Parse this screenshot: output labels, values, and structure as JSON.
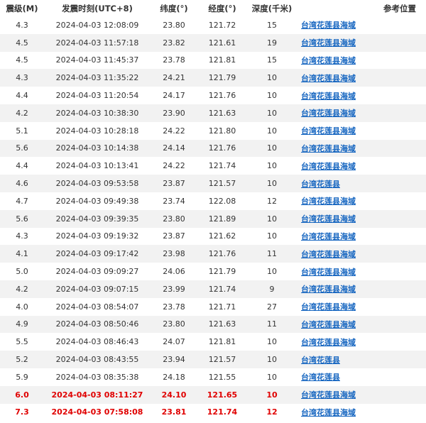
{
  "headers": {
    "magnitude": "震级(M)",
    "time": "发震时刻(UTC+8)",
    "lat": "纬度(°)",
    "lon": "经度(°)",
    "depth": "深度(千米)",
    "location": "参考位置"
  },
  "rows": [
    {
      "mag": "4.3",
      "time": "2024-04-03 12:08:09",
      "lat": "23.80",
      "lon": "121.72",
      "depth": "15",
      "loc": "台湾花莲县海域",
      "highlight": false
    },
    {
      "mag": "4.5",
      "time": "2024-04-03 11:57:18",
      "lat": "23.82",
      "lon": "121.61",
      "depth": "19",
      "loc": "台湾花莲县海域",
      "highlight": false
    },
    {
      "mag": "4.5",
      "time": "2024-04-03 11:45:37",
      "lat": "23.78",
      "lon": "121.81",
      "depth": "15",
      "loc": "台湾花莲县海域",
      "highlight": false
    },
    {
      "mag": "4.3",
      "time": "2024-04-03 11:35:22",
      "lat": "24.21",
      "lon": "121.79",
      "depth": "10",
      "loc": "台湾花莲县海域",
      "highlight": false
    },
    {
      "mag": "4.4",
      "time": "2024-04-03 11:20:54",
      "lat": "24.17",
      "lon": "121.76",
      "depth": "10",
      "loc": "台湾花莲县海域",
      "highlight": false
    },
    {
      "mag": "4.2",
      "time": "2024-04-03 10:38:30",
      "lat": "23.90",
      "lon": "121.63",
      "depth": "10",
      "loc": "台湾花莲县海域",
      "highlight": false
    },
    {
      "mag": "5.1",
      "time": "2024-04-03 10:28:18",
      "lat": "24.22",
      "lon": "121.80",
      "depth": "10",
      "loc": "台湾花莲县海域",
      "highlight": false
    },
    {
      "mag": "5.6",
      "time": "2024-04-03 10:14:38",
      "lat": "24.14",
      "lon": "121.76",
      "depth": "10",
      "loc": "台湾花莲县海域",
      "highlight": false
    },
    {
      "mag": "4.4",
      "time": "2024-04-03 10:13:41",
      "lat": "24.22",
      "lon": "121.74",
      "depth": "10",
      "loc": "台湾花莲县海域",
      "highlight": false
    },
    {
      "mag": "4.6",
      "time": "2024-04-03 09:53:58",
      "lat": "23.87",
      "lon": "121.57",
      "depth": "10",
      "loc": "台湾花莲县",
      "highlight": false
    },
    {
      "mag": "4.7",
      "time": "2024-04-03 09:49:38",
      "lat": "23.74",
      "lon": "122.08",
      "depth": "12",
      "loc": "台湾花莲县海域",
      "highlight": false
    },
    {
      "mag": "5.6",
      "time": "2024-04-03 09:39:35",
      "lat": "23.80",
      "lon": "121.89",
      "depth": "10",
      "loc": "台湾花莲县海域",
      "highlight": false
    },
    {
      "mag": "4.3",
      "time": "2024-04-03 09:19:32",
      "lat": "23.87",
      "lon": "121.62",
      "depth": "10",
      "loc": "台湾花莲县海域",
      "highlight": false
    },
    {
      "mag": "4.1",
      "time": "2024-04-03 09:17:42",
      "lat": "23.98",
      "lon": "121.76",
      "depth": "11",
      "loc": "台湾花莲县海域",
      "highlight": false
    },
    {
      "mag": "5.0",
      "time": "2024-04-03 09:09:27",
      "lat": "24.06",
      "lon": "121.79",
      "depth": "10",
      "loc": "台湾花莲县海域",
      "highlight": false
    },
    {
      "mag": "4.2",
      "time": "2024-04-03 09:07:15",
      "lat": "23.99",
      "lon": "121.74",
      "depth": "9",
      "loc": "台湾花莲县海域",
      "highlight": false
    },
    {
      "mag": "4.0",
      "time": "2024-04-03 08:54:07",
      "lat": "23.78",
      "lon": "121.71",
      "depth": "27",
      "loc": "台湾花莲县海域",
      "highlight": false
    },
    {
      "mag": "4.9",
      "time": "2024-04-03 08:50:46",
      "lat": "23.80",
      "lon": "121.63",
      "depth": "11",
      "loc": "台湾花莲县海域",
      "highlight": false
    },
    {
      "mag": "5.5",
      "time": "2024-04-03 08:46:43",
      "lat": "24.07",
      "lon": "121.81",
      "depth": "10",
      "loc": "台湾花莲县海域",
      "highlight": false
    },
    {
      "mag": "5.2",
      "time": "2024-04-03 08:43:55",
      "lat": "23.94",
      "lon": "121.57",
      "depth": "10",
      "loc": "台湾花莲县",
      "highlight": false
    },
    {
      "mag": "5.9",
      "time": "2024-04-03 08:35:38",
      "lat": "24.18",
      "lon": "121.55",
      "depth": "10",
      "loc": "台湾花莲县",
      "highlight": false
    },
    {
      "mag": "6.0",
      "time": "2024-04-03 08:11:27",
      "lat": "24.10",
      "lon": "121.65",
      "depth": "10",
      "loc": "台湾花莲县海域",
      "highlight": true
    },
    {
      "mag": "7.3",
      "time": "2024-04-03 07:58:08",
      "lat": "23.81",
      "lon": "121.74",
      "depth": "12",
      "loc": "台湾花莲县海域",
      "highlight": true
    }
  ],
  "colors": {
    "link": "#1565c0",
    "highlight": "#e00000",
    "stripe": "#f2f2f2",
    "text": "#333333"
  }
}
